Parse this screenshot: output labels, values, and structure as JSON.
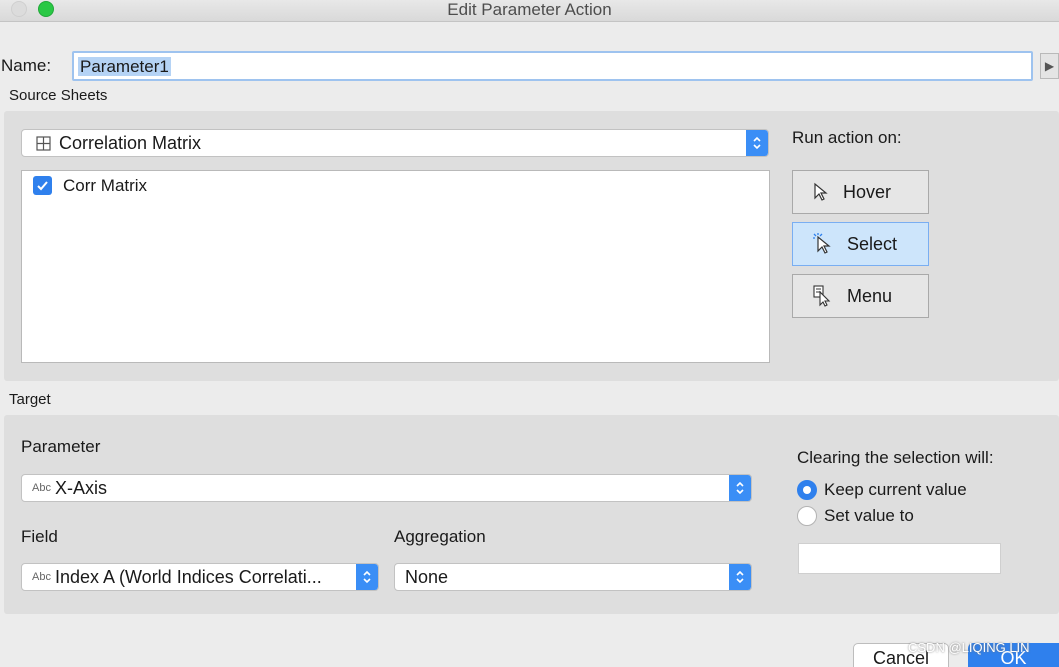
{
  "window": {
    "title": "Edit Parameter Action"
  },
  "name": {
    "label": "Name:",
    "value": "Parameter1",
    "arrow_icon": "play-arrow-icon"
  },
  "source_sheets": {
    "label": "Source Sheets",
    "dashboard_dropdown": {
      "value": "Correlation Matrix",
      "icon": "grid-icon"
    },
    "sheets": [
      {
        "label": "Corr Matrix",
        "checked": true
      }
    ]
  },
  "run_action": {
    "label": "Run action on:",
    "options": [
      {
        "label": "Hover",
        "icon": "cursor-icon",
        "selected": false
      },
      {
        "label": "Select",
        "icon": "select-cursor-icon",
        "selected": true
      },
      {
        "label": "Menu",
        "icon": "menu-cursor-icon",
        "selected": false
      }
    ]
  },
  "target": {
    "label": "Target",
    "parameter": {
      "label": "Parameter",
      "type_tag": "Abc",
      "value": "X-Axis"
    },
    "field": {
      "label": "Field",
      "type_tag": "Abc",
      "value": "Index A (World Indices Correlati..."
    },
    "aggregation": {
      "label": "Aggregation",
      "value": "None"
    },
    "clearing": {
      "label": "Clearing the selection will:",
      "options": [
        {
          "label": "Keep current value",
          "selected": true
        },
        {
          "label": "Set value to",
          "selected": false
        }
      ],
      "value": ""
    }
  },
  "footer": {
    "cancel_label": "Cancel",
    "ok_label": "OK",
    "watermark": "CSDN @LIQING LIN"
  },
  "colors": {
    "accent": "#2f80ed",
    "selected_button": "#cde5fb",
    "panel": "#dedede",
    "window": "#ececec"
  }
}
